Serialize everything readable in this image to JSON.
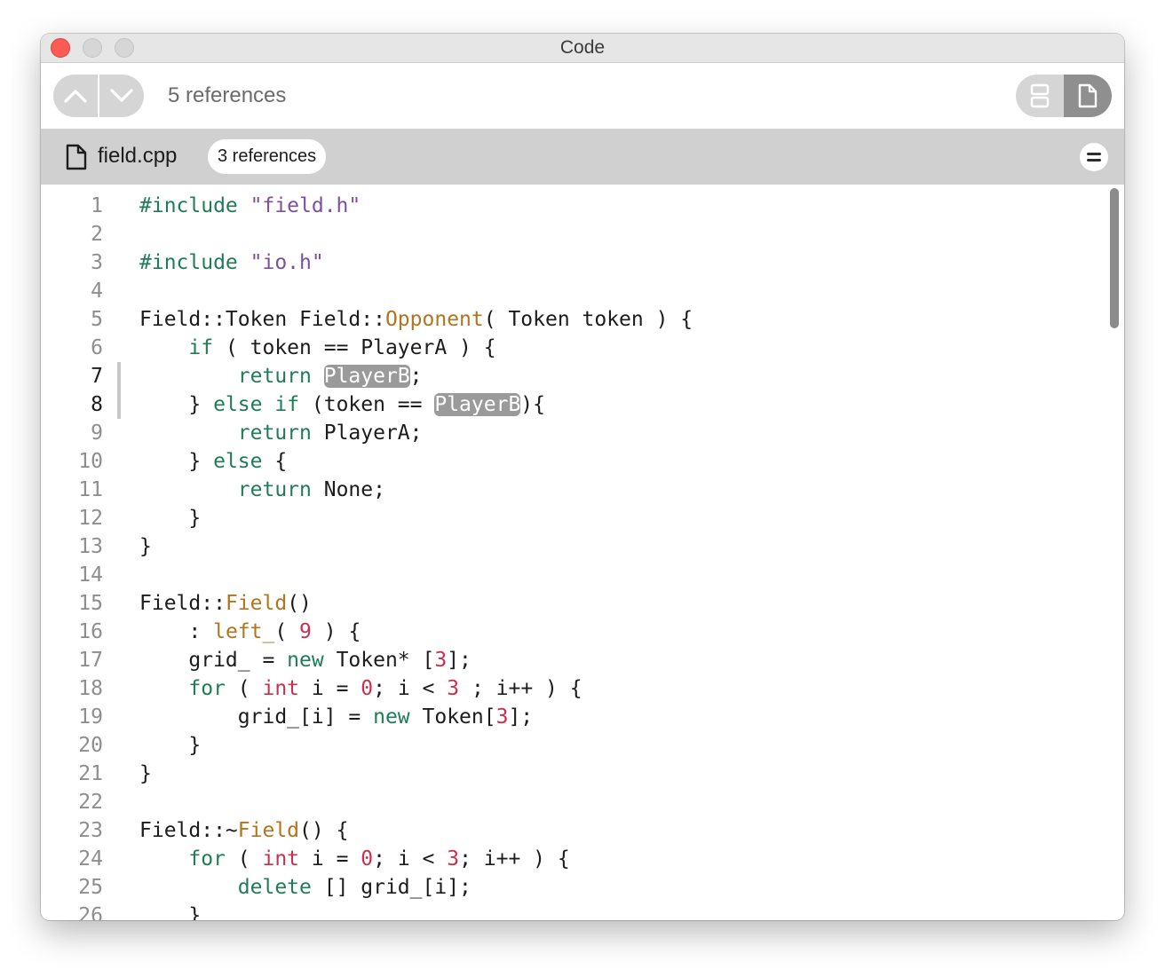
{
  "window": {
    "title": "Code"
  },
  "toolbar": {
    "reference_count": "5 references",
    "up_icon": "chevron-up-icon",
    "down_icon": "chevron-down-icon",
    "view_split_icon": "split-view-icon",
    "view_file_icon": "file-view-icon"
  },
  "file": {
    "name": "field.cpp",
    "badge": "3 references",
    "icon": "document-icon",
    "collapse_icon": "collapse-icon"
  },
  "colors": {
    "keyword": "#1e7d57",
    "string": "#7c4f9f",
    "function": "#b2741c",
    "number": "#c9304e",
    "highlight": "#9a9a9a",
    "close_button": "#fd5b53"
  },
  "code": {
    "current_lines": [
      7,
      8
    ],
    "lines": [
      {
        "n": "1",
        "tokens": [
          [
            "#include ",
            "kw"
          ],
          [
            "\"field.h\"",
            "str"
          ]
        ]
      },
      {
        "n": "2",
        "tokens": []
      },
      {
        "n": "3",
        "tokens": [
          [
            "#include ",
            "kw"
          ],
          [
            "\"io.h\"",
            "str"
          ]
        ]
      },
      {
        "n": "4",
        "tokens": []
      },
      {
        "n": "5",
        "tokens": [
          [
            "Field::Token Field::",
            ""
          ],
          [
            "Opponent",
            "fn"
          ],
          [
            "( Token token ) {",
            ""
          ]
        ]
      },
      {
        "n": "6",
        "tokens": [
          [
            "    ",
            ""
          ],
          [
            "if",
            "kw"
          ],
          [
            " ( token == PlayerA ) {",
            ""
          ]
        ]
      },
      {
        "n": "7",
        "tokens": [
          [
            "        ",
            ""
          ],
          [
            "return",
            "kw"
          ],
          [
            " ",
            ""
          ],
          [
            "PlayerB",
            "hl"
          ],
          [
            ";",
            ""
          ]
        ]
      },
      {
        "n": "8",
        "tokens": [
          [
            "    } ",
            ""
          ],
          [
            "else if",
            "kw"
          ],
          [
            " (token == ",
            ""
          ],
          [
            "PlayerB",
            "hl"
          ],
          [
            "){",
            ""
          ]
        ]
      },
      {
        "n": "9",
        "tokens": [
          [
            "        ",
            ""
          ],
          [
            "return",
            "kw"
          ],
          [
            " PlayerA;",
            ""
          ]
        ]
      },
      {
        "n": "10",
        "tokens": [
          [
            "    } ",
            ""
          ],
          [
            "else",
            "kw"
          ],
          [
            " {",
            ""
          ]
        ]
      },
      {
        "n": "11",
        "tokens": [
          [
            "        ",
            ""
          ],
          [
            "return",
            "kw"
          ],
          [
            " None;",
            ""
          ]
        ]
      },
      {
        "n": "12",
        "tokens": [
          [
            "    }",
            ""
          ]
        ]
      },
      {
        "n": "13",
        "tokens": [
          [
            "}",
            ""
          ]
        ]
      },
      {
        "n": "14",
        "tokens": []
      },
      {
        "n": "15",
        "tokens": [
          [
            "Field::",
            ""
          ],
          [
            "Field",
            "fn"
          ],
          [
            "()",
            ""
          ]
        ]
      },
      {
        "n": "16",
        "tokens": [
          [
            "    : ",
            ""
          ],
          [
            "left_",
            "fn"
          ],
          [
            "( ",
            ""
          ],
          [
            "9",
            "num"
          ],
          [
            " ) {",
            ""
          ]
        ]
      },
      {
        "n": "17",
        "tokens": [
          [
            "    grid_ = ",
            ""
          ],
          [
            "new",
            "kw"
          ],
          [
            " Token* [",
            ""
          ],
          [
            "3",
            "num"
          ],
          [
            "];",
            ""
          ]
        ]
      },
      {
        "n": "18",
        "tokens": [
          [
            "    ",
            ""
          ],
          [
            "for",
            "kw"
          ],
          [
            " ( ",
            ""
          ],
          [
            "int",
            "num"
          ],
          [
            " i = ",
            ""
          ],
          [
            "0",
            "num"
          ],
          [
            "; i < ",
            ""
          ],
          [
            "3",
            "num"
          ],
          [
            " ; i++ ) {",
            ""
          ]
        ]
      },
      {
        "n": "19",
        "tokens": [
          [
            "        grid_[i] = ",
            ""
          ],
          [
            "new",
            "kw"
          ],
          [
            " Token[",
            ""
          ],
          [
            "3",
            "num"
          ],
          [
            "];",
            ""
          ]
        ]
      },
      {
        "n": "20",
        "tokens": [
          [
            "    }",
            ""
          ]
        ]
      },
      {
        "n": "21",
        "tokens": [
          [
            "}",
            ""
          ]
        ]
      },
      {
        "n": "22",
        "tokens": []
      },
      {
        "n": "23",
        "tokens": [
          [
            "Field::~",
            ""
          ],
          [
            "Field",
            "fn"
          ],
          [
            "() {",
            ""
          ]
        ]
      },
      {
        "n": "24",
        "tokens": [
          [
            "    ",
            ""
          ],
          [
            "for",
            "kw"
          ],
          [
            " ( ",
            ""
          ],
          [
            "int",
            "num"
          ],
          [
            " i = ",
            ""
          ],
          [
            "0",
            "num"
          ],
          [
            "; i < ",
            ""
          ],
          [
            "3",
            "num"
          ],
          [
            "; i++ ) {",
            ""
          ]
        ]
      },
      {
        "n": "25",
        "tokens": [
          [
            "        ",
            ""
          ],
          [
            "delete",
            "kw"
          ],
          [
            " [] grid_[i];",
            ""
          ]
        ]
      },
      {
        "n": "26",
        "tokens": [
          [
            "    }",
            ""
          ]
        ]
      }
    ]
  }
}
